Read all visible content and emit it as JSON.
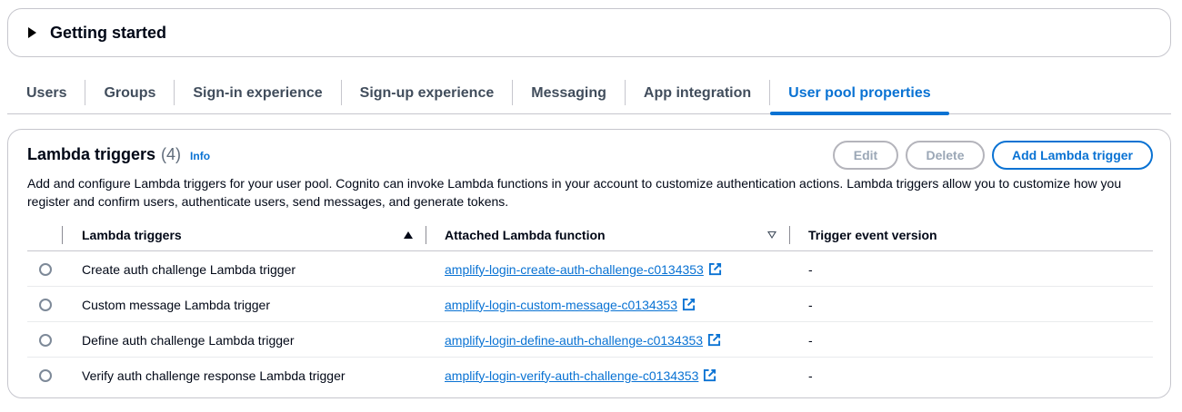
{
  "getting_started": {
    "title": "Getting started",
    "icon": "caret-right-icon"
  },
  "tabs": [
    {
      "label": "Users"
    },
    {
      "label": "Groups"
    },
    {
      "label": "Sign-in experience"
    },
    {
      "label": "Sign-up experience"
    },
    {
      "label": "Messaging"
    },
    {
      "label": "App integration"
    },
    {
      "label": "User pool properties",
      "active": true
    }
  ],
  "panel": {
    "title": "Lambda triggers",
    "count": "(4)",
    "info": "Info",
    "buttons": {
      "edit": "Edit",
      "delete": "Delete",
      "add": "Add Lambda trigger"
    },
    "description": "Add and configure Lambda triggers for your user pool. Cognito can invoke Lambda functions in your account to customize authentication actions. Lambda triggers allow you to customize how you register and confirm users, authenticate users, send messages, and generate tokens."
  },
  "table": {
    "headers": {
      "name": "Lambda triggers",
      "function": "Attached Lambda function",
      "version": "Trigger event version"
    },
    "rows": [
      {
        "name": "Create auth challenge Lambda trigger",
        "function": "amplify-login-create-auth-challenge-c0134353",
        "version": "-"
      },
      {
        "name": "Custom message Lambda trigger",
        "function": "amplify-login-custom-message-c0134353",
        "version": "-"
      },
      {
        "name": "Define auth challenge Lambda trigger",
        "function": "amplify-login-define-auth-challenge-c0134353",
        "version": "-"
      },
      {
        "name": "Verify auth challenge response Lambda trigger",
        "function": "amplify-login-verify-auth-challenge-c0134353",
        "version": "-"
      }
    ]
  },
  "colors": {
    "accent": "#0972d3",
    "text": "#000716",
    "border": "#c6c6cd"
  }
}
